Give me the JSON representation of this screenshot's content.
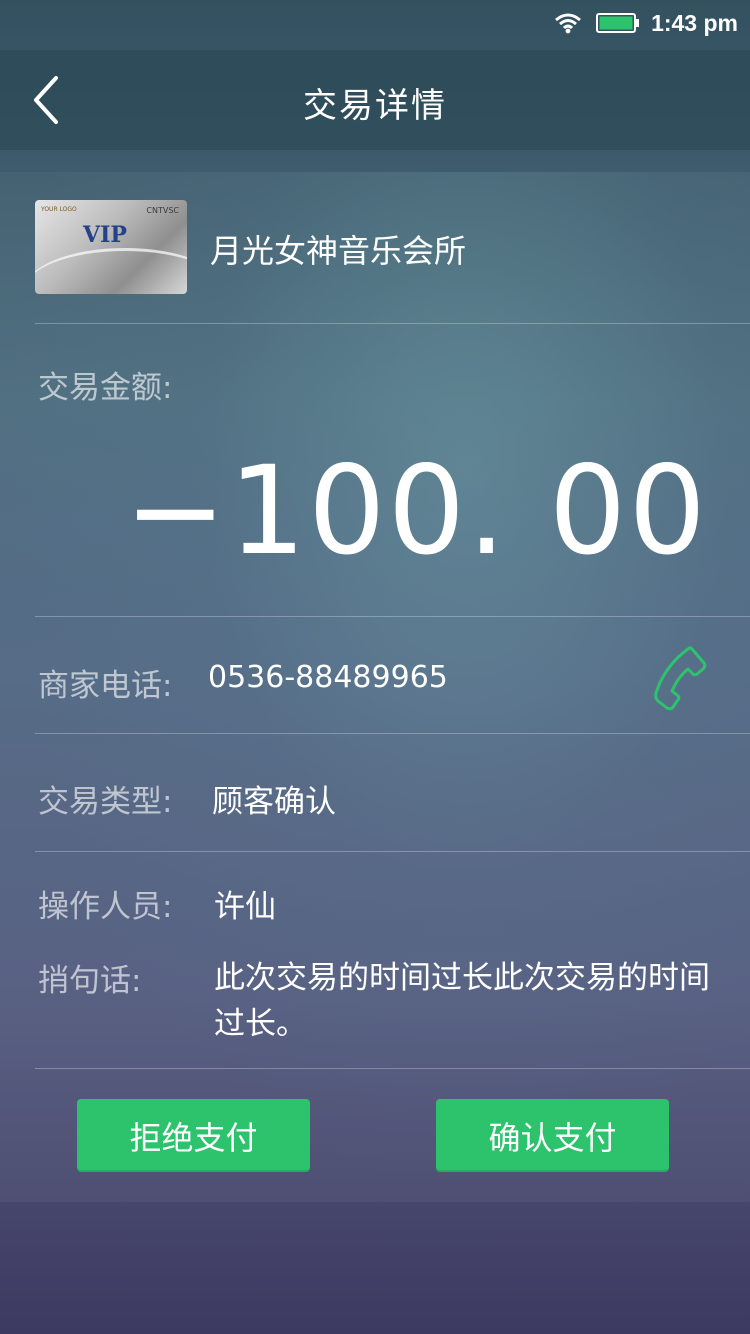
{
  "status_bar": {
    "time": "1:43 pm",
    "wifi_icon": "wifi-icon",
    "battery_icon": "battery-icon",
    "battery_color": "#2dc36c"
  },
  "nav": {
    "title": "交易详情",
    "back_icon": "chevron-left-icon"
  },
  "merchant": {
    "name": "月光女神音乐会所",
    "card_image": {
      "main_text": "VIP",
      "brand_text": "CNTVSC",
      "logo_text": "YOUR LOGO"
    }
  },
  "amount": {
    "label": "交易金额:",
    "value": "−100. 00"
  },
  "details": {
    "phone_label": "商家电话:",
    "phone_value": "0536-88489965",
    "phone_icon": "phone-icon",
    "phone_icon_color": "#2dc36c",
    "type_label": "交易类型:",
    "type_value": "顾客确认",
    "operator_label": "操作人员:",
    "operator_value": "许仙",
    "remark_label": "捎句话:",
    "remark_value": "此次交易的时间过长此次交易的时间过长。"
  },
  "actions": {
    "reject_label": "拒绝支付",
    "confirm_label": "确认支付",
    "accent": "#2dc36c"
  }
}
